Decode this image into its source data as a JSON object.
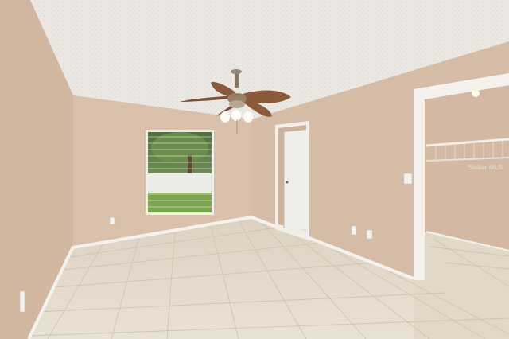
{
  "scene": {
    "description_tags": [
      "empty-bedroom",
      "ceiling-fan",
      "window",
      "closet",
      "tile-floor"
    ],
    "colors": {
      "ceiling": "#ece9e4",
      "wall_left": "#d3b9a2",
      "wall_back": "#d6bea8",
      "wall_right": "#d4bba5",
      "floor": "#e4dac9",
      "baseboard": "#f4f1ec",
      "door": "#eeeeec",
      "fan_blade": "#8b5a3c"
    },
    "watermark": "Stellar MLS"
  }
}
